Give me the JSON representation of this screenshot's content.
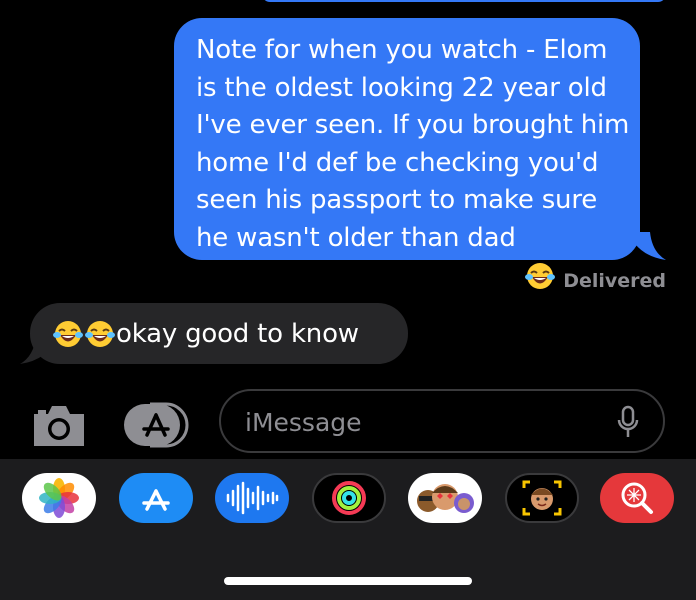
{
  "conversation": {
    "sent_message": "Note for when you watch - Elom\nis the oldest looking 22 year old\nI've ever seen. If you brought him\nhome I'd def be checking you'd\nseen his passport to make sure\nhe wasn't older than dad",
    "sent_status": "Delivered",
    "received_message": "okay good to know"
  },
  "compose": {
    "placeholder": "iMessage"
  },
  "app_drawer": {
    "items": [
      "photos-app-icon",
      "app-store-icon",
      "audio-message-icon",
      "activity-icon",
      "memoji-stickers-icon",
      "memoji-camera-icon",
      "images-search-icon"
    ]
  },
  "colors": {
    "sent_bubble": "#3478f6",
    "received_bubble": "#262628",
    "drawer_background": "#1c1c1e"
  }
}
